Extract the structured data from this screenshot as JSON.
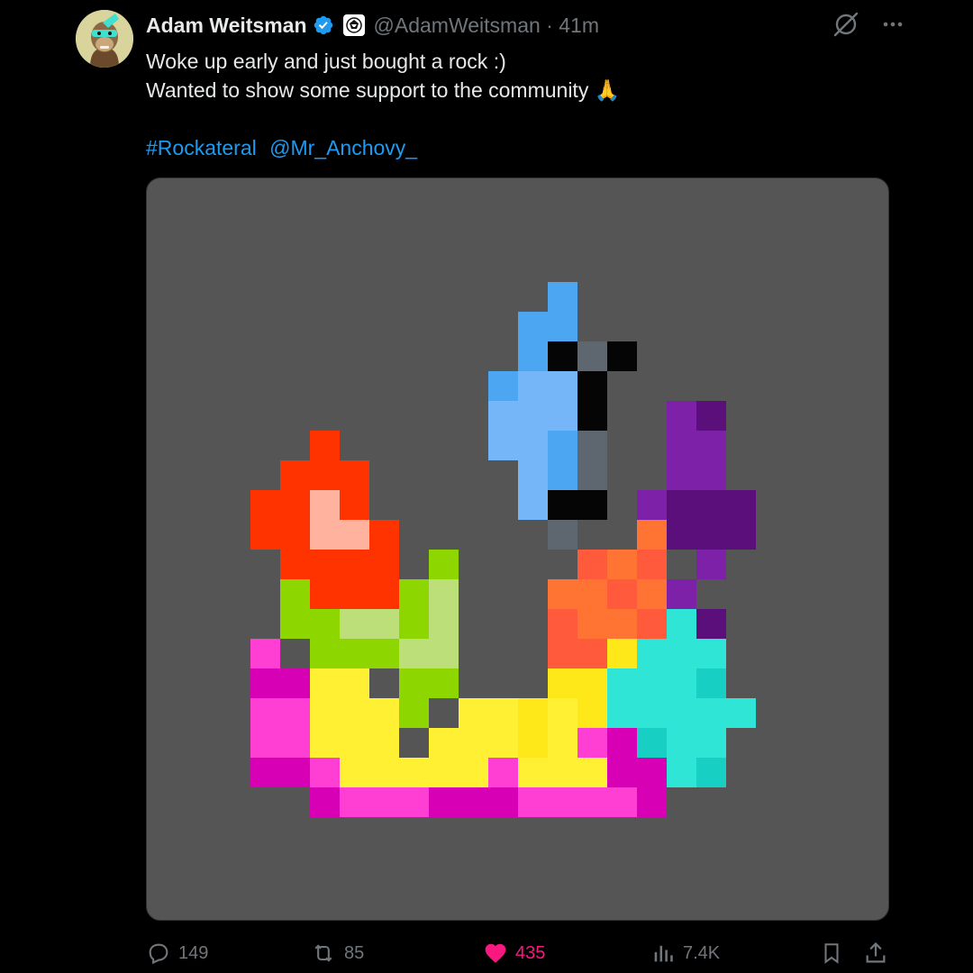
{
  "tweet": {
    "author": {
      "name": "Adam Weitsman",
      "handle": "@AdamWeitsman",
      "verified": true
    },
    "time_separator": " · ",
    "time": "41m",
    "text_lines": [
      "Woke up early and just bought a rock :)",
      "Wanted to show some support to the community 🙏"
    ],
    "hashtag": "#Rockateral",
    "mention": "@Mr_Anchovy_",
    "media": {
      "background_color": "#555555",
      "description_icon": "pixel-art-rock"
    },
    "actions": {
      "replies": "149",
      "retweets": "85",
      "likes": "435",
      "views": "7.4K"
    }
  },
  "colors": {
    "background": "#000000",
    "primary_text": "#e7e9ea",
    "secondary_text": "#71767b",
    "link": "#1d9bf0",
    "like": "#f91880",
    "verified": "#1d9bf0"
  },
  "icons": {
    "verified": "verified-badge-icon",
    "affiliation": "affiliation-logo-icon",
    "grok": "grok-icon",
    "more": "more-options-icon",
    "reply": "reply-icon",
    "retweet": "retweet-icon",
    "like": "heart-icon",
    "views": "views-chart-icon",
    "bookmark": "bookmark-icon",
    "share": "share-icon"
  }
}
